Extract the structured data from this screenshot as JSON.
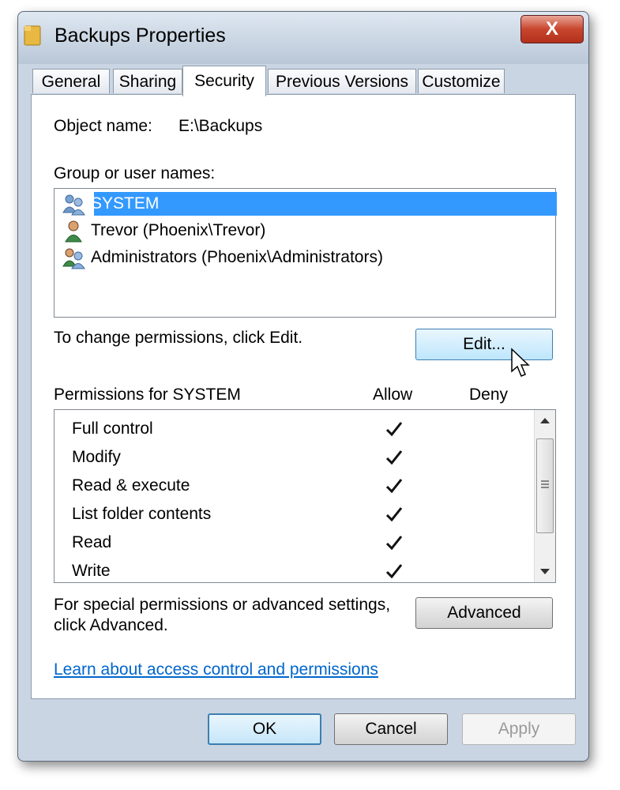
{
  "window": {
    "title": "Backups Properties",
    "close_label": "X"
  },
  "tabs": [
    {
      "label": "General",
      "active": false
    },
    {
      "label": "Sharing",
      "active": false
    },
    {
      "label": "Security",
      "active": true
    },
    {
      "label": "Previous Versions",
      "active": false
    },
    {
      "label": "Customize",
      "active": false
    }
  ],
  "object": {
    "label": "Object name:",
    "value": "E:\\Backups"
  },
  "groups": {
    "label": "Group or user names:",
    "items": [
      {
        "name": "SYSTEM",
        "icon": "group-users-icon",
        "selected": true
      },
      {
        "name": "Trevor (Phoenix\\Trevor)",
        "icon": "user-icon",
        "selected": false
      },
      {
        "name": "Administrators (Phoenix\\Administrators)",
        "icon": "group-users-icon",
        "selected": false
      }
    ]
  },
  "change": {
    "text": "To change permissions, click Edit.",
    "edit_label": "Edit..."
  },
  "permissions": {
    "label": "Permissions for SYSTEM",
    "allow_label": "Allow",
    "deny_label": "Deny",
    "items": [
      {
        "name": "Full control",
        "allow": true,
        "deny": false
      },
      {
        "name": "Modify",
        "allow": true,
        "deny": false
      },
      {
        "name": "Read & execute",
        "allow": true,
        "deny": false
      },
      {
        "name": "List folder contents",
        "allow": true,
        "deny": false
      },
      {
        "name": "Read",
        "allow": true,
        "deny": false
      },
      {
        "name": "Write",
        "allow": true,
        "deny": false
      }
    ]
  },
  "advanced": {
    "text_line1": "For special permissions or advanced settings,",
    "text_line2": "click Advanced.",
    "button_label": "Advanced"
  },
  "link": {
    "text": "Learn about access control and permissions"
  },
  "footer": {
    "ok_label": "OK",
    "cancel_label": "Cancel",
    "apply_label": "Apply"
  },
  "colors": {
    "selection": "#3399ff",
    "link": "#0066cc",
    "close": "#c8452d"
  }
}
